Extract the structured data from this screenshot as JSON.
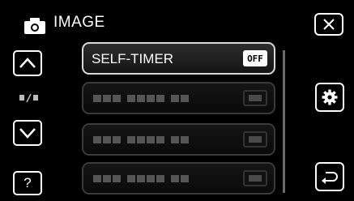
{
  "header": {
    "title": "IMAGE",
    "icon": "camera-icon"
  },
  "nav": {
    "help_label": "?",
    "up_icon": "chevron-up-icon",
    "down_icon": "chevron-down-icon"
  },
  "menu": {
    "items": [
      {
        "label": "SELF-TIMER",
        "value": "OFF",
        "active": true
      }
    ]
  },
  "buttons": {
    "close_icon": "close-icon",
    "settings_icon": "gear-icon",
    "back_icon": "return-icon"
  },
  "colors": {
    "background": "#000000",
    "foreground": "#ffffff",
    "inactive_border": "#3a3a3a"
  }
}
